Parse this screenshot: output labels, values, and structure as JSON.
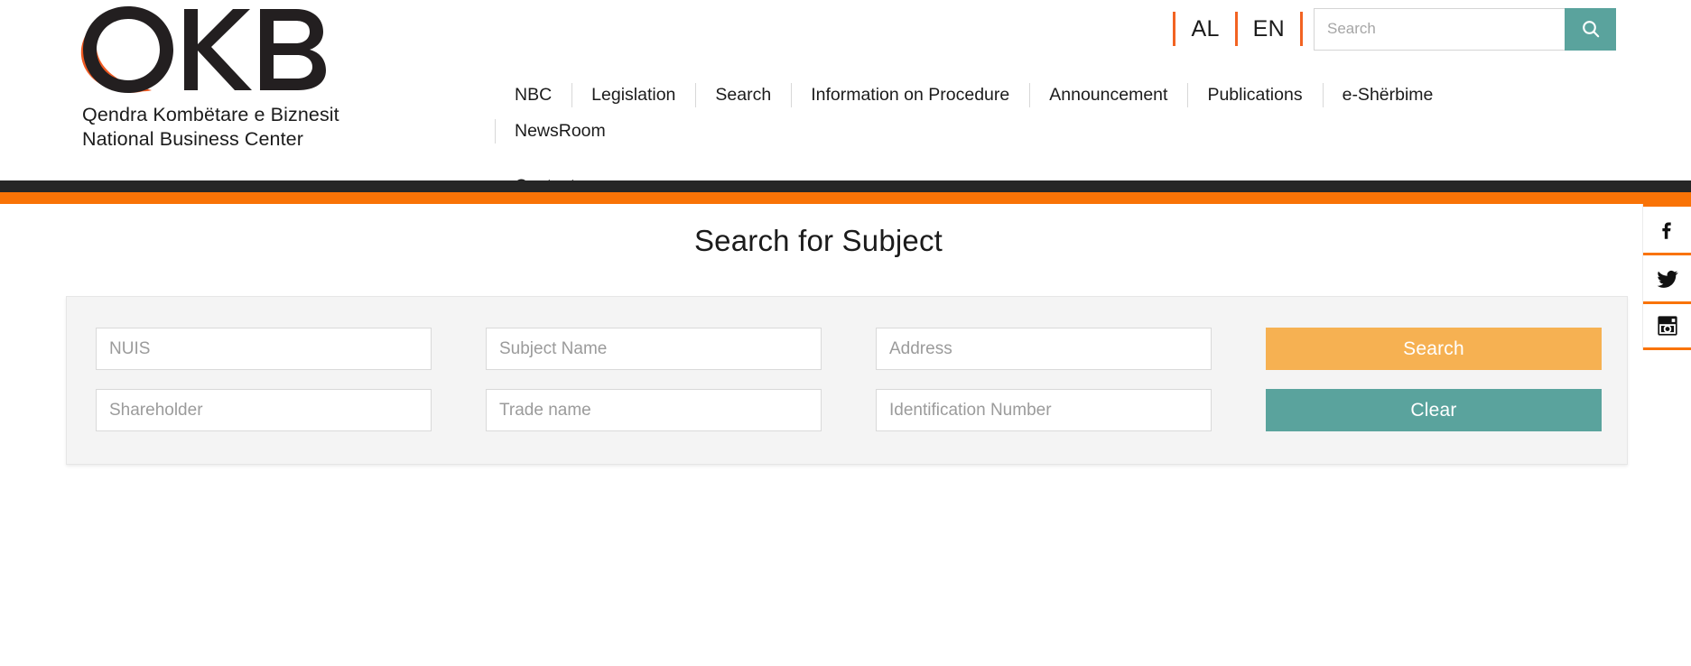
{
  "brand": {
    "logo_text": "QKB",
    "tagline_al": "Qendra Kombëtare e Biznesit",
    "tagline_en": "National Business Center"
  },
  "header": {
    "languages": [
      {
        "code": "AL",
        "label": "AL",
        "active": false
      },
      {
        "code": "EN",
        "label": "EN",
        "active": true
      }
    ],
    "search": {
      "value": "",
      "placeholder": "Search",
      "button_icon": "search-icon"
    },
    "nav_row1": [
      {
        "label": "NBC"
      },
      {
        "label": "Legislation"
      },
      {
        "label": "Search"
      },
      {
        "label": "Information on Procedure"
      },
      {
        "label": "Announcement"
      },
      {
        "label": "Publications"
      },
      {
        "label": "e-Shërbime"
      },
      {
        "label": "NewsRoom"
      }
    ],
    "nav_row2": [
      {
        "label": "Contact"
      }
    ]
  },
  "main": {
    "page_title": "Search for Subject",
    "form": {
      "fields": [
        {
          "name": "nuis",
          "placeholder": "NUIS",
          "value": ""
        },
        {
          "name": "subject-name",
          "placeholder": "Subject Name",
          "value": ""
        },
        {
          "name": "address",
          "placeholder": "Address",
          "value": ""
        },
        {
          "name": "shareholder",
          "placeholder": "Shareholder",
          "value": ""
        },
        {
          "name": "trade-name",
          "placeholder": "Trade name",
          "value": ""
        },
        {
          "name": "identification-number",
          "placeholder": "Identification Number",
          "value": ""
        }
      ],
      "search_button": "Search",
      "clear_button": "Clear"
    }
  },
  "social": [
    {
      "name": "facebook",
      "label": "Facebook"
    },
    {
      "name": "twitter",
      "label": "Twitter"
    },
    {
      "name": "instagram",
      "label": "Instagram"
    }
  ],
  "colors": {
    "orange": "#f97306",
    "logo_orange": "#f05a22",
    "dark_bar": "#262626",
    "teal": "#5aa39d",
    "amber": "#f6b152",
    "panel_bg": "#f4f4f4"
  }
}
